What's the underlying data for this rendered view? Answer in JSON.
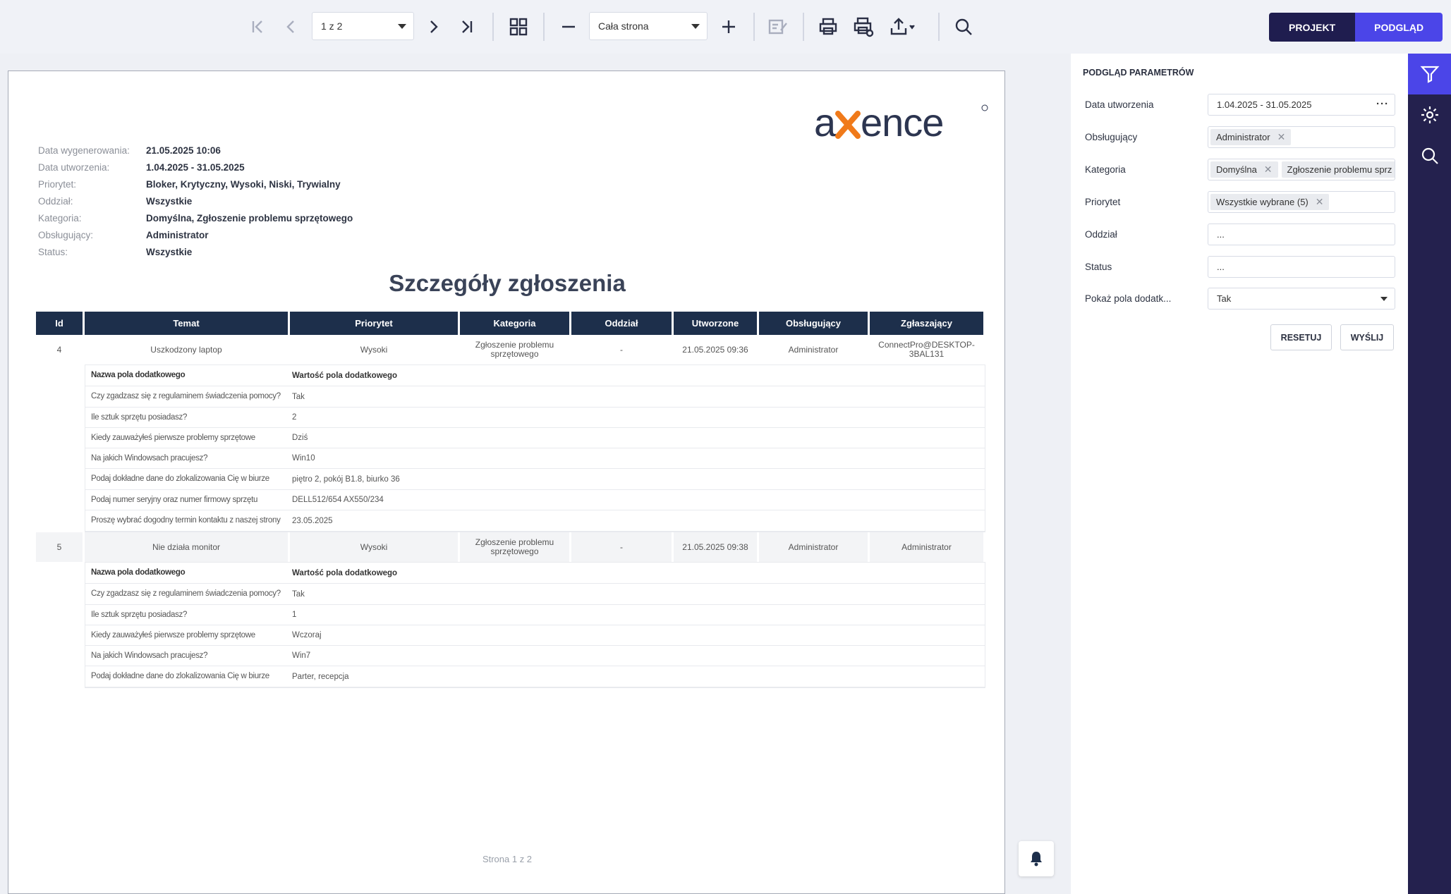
{
  "toolbar": {
    "page_selector": "1 z 2",
    "zoom_selector": "Cała strona"
  },
  "modes": {
    "design": "PROJEKT",
    "preview": "PODGLĄD",
    "design_color": "#1f1d4f",
    "preview_color": "#4b45e8"
  },
  "report": {
    "meta": [
      {
        "label": "Data wygenerowania:",
        "value": "21.05.2025 10:06"
      },
      {
        "label": "Data utworzenia:",
        "value": "1.04.2025 - 31.05.2025"
      },
      {
        "label": "Priorytet:",
        "value": "Bloker, Krytyczny, Wysoki, Niski, Trywialny"
      },
      {
        "label": "Oddział:",
        "value": "Wszystkie"
      },
      {
        "label": "Kategoria:",
        "value": "Domyślna, Zgłoszenie problemu sprzętowego"
      },
      {
        "label": "Obsługujący:",
        "value": "Administrator"
      },
      {
        "label": "Status:",
        "value": "Wszystkie"
      }
    ],
    "title": "Szczegóły zgłoszenia",
    "columns": [
      "Id",
      "Temat",
      "Priorytet",
      "Kategoria",
      "Oddział",
      "Utworzone",
      "Obsługujący",
      "Zgłaszający"
    ],
    "subtable_header": {
      "key": "Nazwa pola dodatkowego",
      "value": "Wartość pola dodatkowego"
    },
    "rows": [
      {
        "cells": [
          "4",
          "Uszkodzony laptop",
          "Wysoki",
          "Zgłoszenie problemu sprzętowego",
          "-",
          "21.05.2025 09:36",
          "Administrator",
          "ConnectPro@DESKTOP-3BAL131"
        ],
        "extra": [
          {
            "key": "Czy zgadzasz się z regulaminem świadczenia pomocy?",
            "value": "Tak"
          },
          {
            "key": "Ile sztuk sprzętu posiadasz?",
            "value": "2"
          },
          {
            "key": "Kiedy zauważyłeś pierwsze problemy sprzętowe",
            "value": "Dziś"
          },
          {
            "key": "Na jakich Windowsach pracujesz?",
            "value": "Win10"
          },
          {
            "key": "Podaj dokładne dane do zlokalizowania Cię w biurze",
            "value": "piętro 2, pokój B1.8, biurko 36"
          },
          {
            "key": "Podaj numer seryjny oraz numer firmowy sprzętu",
            "value": "DELL512/654 AX550/234"
          },
          {
            "key": "Proszę wybrać dogodny termin kontaktu z naszej strony",
            "value": "23.05.2025"
          }
        ]
      },
      {
        "cells": [
          "5",
          "Nie działa monitor",
          "Wysoki",
          "Zgłoszenie problemu sprzętowego",
          "-",
          "21.05.2025 09:38",
          "Administrator",
          "Administrator"
        ],
        "extra": [
          {
            "key": "Czy zgadzasz się z regulaminem świadczenia pomocy?",
            "value": "Tak"
          },
          {
            "key": "Ile sztuk sprzętu posiadasz?",
            "value": "1"
          },
          {
            "key": "Kiedy zauważyłeś pierwsze problemy sprzętowe",
            "value": "Wczoraj"
          },
          {
            "key": "Na jakich Windowsach pracujesz?",
            "value": "Win7"
          },
          {
            "key": "Podaj dokładne dane do zlokalizowania Cię w biurze",
            "value": "Parter, recepcja"
          }
        ]
      }
    ],
    "footer": "Strona 1 z 2",
    "logo_text": "axence",
    "logo_accent": "#f07a1a",
    "header_color": "#1d2f4b"
  },
  "params": {
    "title": "PODGLĄD PARAMETRÓW",
    "fields": [
      {
        "label": "Data utworzenia",
        "value": "1.04.2025 - 31.05.2025"
      },
      {
        "label": "Obsługujący",
        "chips": [
          "Administrator"
        ]
      },
      {
        "label": "Kategoria",
        "chips": [
          "Domyślna",
          "Zgłoszenie problemu sprz"
        ]
      },
      {
        "label": "Priorytet",
        "chips": [
          "Wszystkie wybrane (5)"
        ]
      },
      {
        "label": "Oddział",
        "value": "..."
      },
      {
        "label": "Status",
        "value": "..."
      },
      {
        "label": "Pokaż pola dodatk...",
        "value": "Tak"
      }
    ],
    "reset": "RESETUJ",
    "send": "WYŚLIJ"
  },
  "sidenav": [
    "filter-icon",
    "gear-icon",
    "search-icon"
  ]
}
